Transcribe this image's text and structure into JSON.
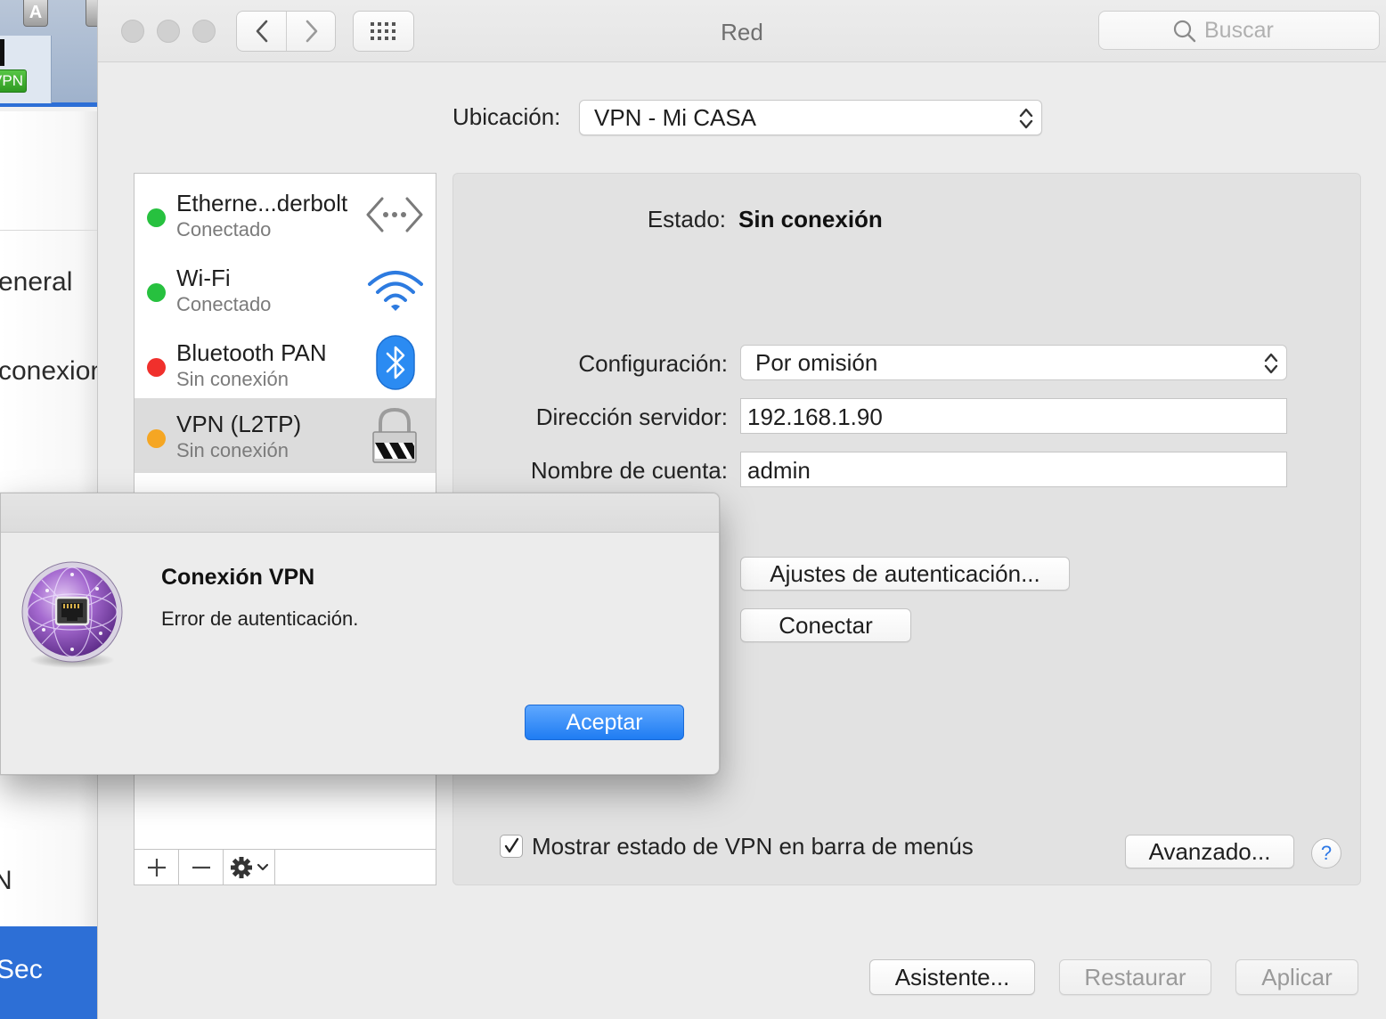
{
  "background_window": {
    "key_label": "A",
    "vpn_badge": "VPN",
    "text_general": "eneral",
    "text_conexion": "conexion",
    "text_n": "N",
    "text_sec": "Sec"
  },
  "window": {
    "title": "Red",
    "search_placeholder": "Buscar"
  },
  "location": {
    "label": "Ubicación:",
    "value": "VPN - Mi CASA"
  },
  "services": [
    {
      "name": "Etherne...derbolt",
      "status": "Conectado",
      "dot_color": "#27c13f",
      "icon": "ethernet-icon"
    },
    {
      "name": "Wi-Fi",
      "status": "Conectado",
      "dot_color": "#27c13f",
      "icon": "wifi-icon"
    },
    {
      "name": "Bluetooth PAN",
      "status": "Sin conexión",
      "dot_color": "#f0302c",
      "icon": "bluetooth-icon"
    },
    {
      "name": "VPN (L2TP)",
      "status": "Sin conexión",
      "dot_color": "#f5a623",
      "icon": "vpn-lock-icon",
      "selected": true
    }
  ],
  "detail": {
    "status_label": "Estado:",
    "status_value": "Sin conexión",
    "config_label": "Configuración:",
    "config_value": "Por omisión",
    "server_label": "Dirección servidor:",
    "server_value": "192.168.1.90",
    "account_label": "Nombre de cuenta:",
    "account_value": "admin",
    "auth_button": "Ajustes de autenticación...",
    "connect_button": "Conectar",
    "show_status_checkbox": "Mostrar estado de VPN en barra de menús",
    "show_status_checked": true,
    "advanced_button": "Avanzado...",
    "help_button": "?"
  },
  "footer": {
    "assistant_button": "Asistente...",
    "revert_button": "Restaurar",
    "apply_button": "Aplicar"
  },
  "dialog": {
    "title": "Conexión VPN",
    "message": "Error de autenticación.",
    "ok_button": "Aceptar"
  },
  "colors": {
    "accent": "#2d78e6",
    "connected": "#27c13f",
    "disconnected": "#f0302c",
    "pending": "#f5a623"
  }
}
